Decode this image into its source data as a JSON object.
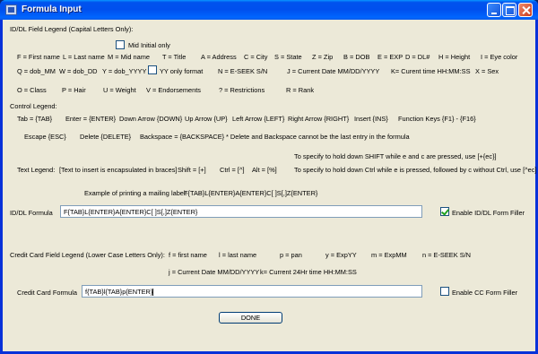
{
  "window": {
    "title": "Formula Input"
  },
  "id_legend": {
    "heading": "ID/DL Field Legend (Capital Letters Only):",
    "mid_initial": "Mid Initial only",
    "row1": [
      "F = First name",
      "L = Last name",
      "M = Mid name",
      "T = Title",
      "A = Address",
      "C = City",
      "S = State",
      "Z = Zip",
      "B = DOB",
      "E = EXP",
      "D = DL#",
      "H = Height",
      "I = Eye color"
    ],
    "row2": [
      "Q = dob_MM",
      "W = dob_DD",
      "Y = dob_YYYY",
      "YY only format",
      "N = E-SEEK S/N",
      "J = Current Date MM/DD/YYYY",
      "K= Curent time HH:MM:SS",
      "X = Sex"
    ],
    "row3": [
      "O = Class",
      "P = Hair",
      "U = Weight",
      "V = Endorsements",
      "? = Restrictions",
      "R = Rank"
    ]
  },
  "control_legend": {
    "heading": "Control Legend:",
    "row1": [
      "Tab = {TAB}",
      "Enter = {ENTER}",
      "Down Arrow {DOWN}",
      "Up Arrow {UP}",
      "Left Arrow {LEFT}",
      "Right Arrow {RIGHT}",
      "Insert {INS}",
      "Function Keys {F1} - {F16}"
    ],
    "row2": [
      "Escape {ESC}",
      "Delete {DELETE}",
      "Backspace = {BACKSPACE}",
      "* Delete and Backspace cannot be the last entry in the formula"
    ]
  },
  "text_legend": {
    "shift_note": "To specify to hold down SHIFT while e and c are pressed, use [+{ec}]",
    "label": "Text Legend:",
    "items": [
      "[Text to insert is encapsulated in braces]",
      "Shift = [+]",
      "Ctrl = [^]",
      "Alt = [%]"
    ],
    "ctrl_note": "To specify to hold down Ctrl while e is pressed, followed by c without Ctrl, use [^ec]"
  },
  "example": {
    "label": "Example of  printing  a mailing label:",
    "formula": "F{TAB}L{ENTER}A{ENTER}C[ ]S[,]Z{ENTER}"
  },
  "id_formula": {
    "label": "ID/DL Formula",
    "value": "F{TAB}L{ENTER}A{ENTER}C[ ]S[,]Z{ENTER}",
    "enable_label": "Enable ID/DL Form Filler",
    "enabled": true
  },
  "cc_legend": {
    "heading": "Credit Card Field Legend (Lower Case Letters Only):",
    "row1": [
      "f = first name",
      "l = last name",
      "p = pan",
      "y = ExpYY",
      "m = ExpMM",
      "n = E-SEEK S/N"
    ],
    "row2": [
      "j = Current Date MM/DD/YYYY",
      "k= Current 24Hr time HH:MM:SS"
    ]
  },
  "cc_formula": {
    "label": "Credit Card Formula",
    "value": "f{TAB}l{TAB}p{ENTER}",
    "enable_label": "Enable CC Form Filler",
    "enabled": false
  },
  "done_button": "DONE"
}
